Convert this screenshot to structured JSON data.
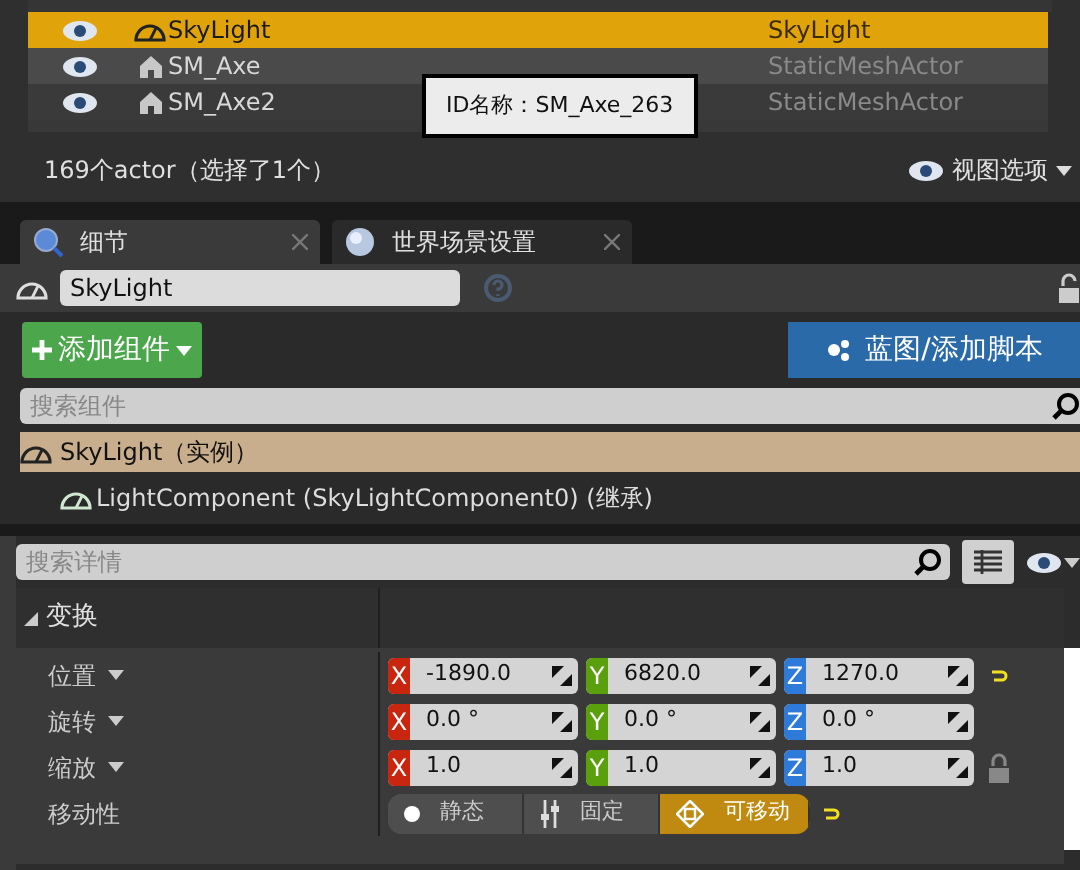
{
  "outliner": {
    "rows": [
      {
        "name": "SkyLight",
        "type": "SkyLight",
        "kind": "light",
        "selected": true,
        "hovered": false
      },
      {
        "name": "SM_Axe",
        "type": "StaticMeshActor",
        "kind": "mesh",
        "selected": false,
        "hovered": true
      },
      {
        "name": "SM_Axe2",
        "type": "StaticMeshActor",
        "kind": "mesh",
        "selected": false,
        "hovered": false
      }
    ],
    "tooltip": "ID名称：SM_Axe_263",
    "status": "169个actor（选择了1个）",
    "view_options": "视图选项"
  },
  "tabs": [
    {
      "label": "细节",
      "kind": "details",
      "selected": true
    },
    {
      "label": "世界场景设置",
      "kind": "world",
      "selected": false
    }
  ],
  "actor_name": "SkyLight",
  "add_component": "添加组件",
  "blueprint_button": "蓝图/添加脚本",
  "component_search": {
    "placeholder": "搜索组件"
  },
  "components": [
    {
      "label": "SkyLight（实例）",
      "selected": true,
      "children": [
        {
          "label": "LightComponent (SkyLightComponent0) (继承)",
          "selected": false
        }
      ]
    }
  ],
  "details_search": {
    "placeholder": "搜索详情"
  },
  "section": {
    "title": "变换",
    "expanded": true
  },
  "properties": [
    {
      "kind": "vector",
      "label": "位置",
      "fields": [
        {
          "axis": "X",
          "value": "-1890.0"
        },
        {
          "axis": "Y",
          "value": "6820.0"
        },
        {
          "axis": "Z",
          "value": "1270.0"
        }
      ],
      "reset": true,
      "lock": false
    },
    {
      "kind": "vector",
      "label": "旋转",
      "fields": [
        {
          "axis": "X",
          "value": "0.0 °"
        },
        {
          "axis": "Y",
          "value": "0.0 °"
        },
        {
          "axis": "Z",
          "value": "0.0 °"
        }
      ],
      "reset": false,
      "lock": false
    },
    {
      "kind": "vector",
      "label": "缩放",
      "fields": [
        {
          "axis": "X",
          "value": "1.0"
        },
        {
          "axis": "Y",
          "value": "1.0"
        },
        {
          "axis": "Z",
          "value": "1.0"
        }
      ],
      "reset": false,
      "lock": true
    },
    {
      "kind": "mobility",
      "label": "移动性",
      "options": [
        {
          "label": "静态",
          "selected": false
        },
        {
          "label": "固定",
          "selected": false
        },
        {
          "label": "可移动",
          "selected": true
        }
      ],
      "reset": true
    }
  ]
}
